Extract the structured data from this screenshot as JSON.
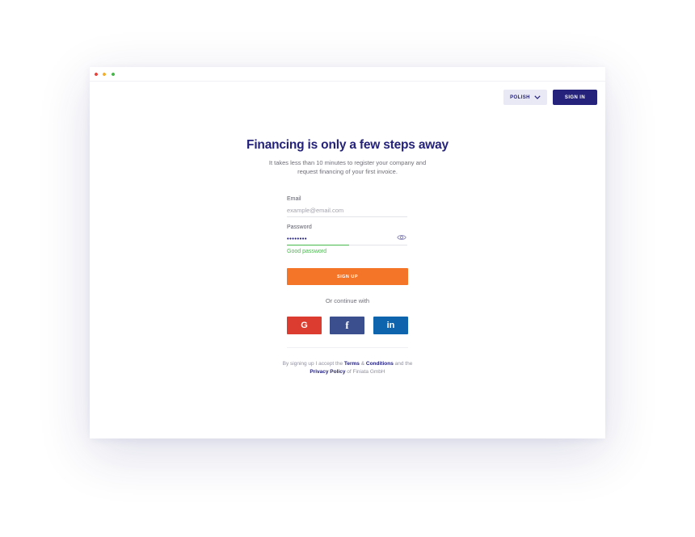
{
  "header": {
    "language_button": "POLISH",
    "signin_button": "SIGN IN"
  },
  "hero": {
    "title": "Financing is only a few steps away",
    "subtitle": "It takes less than 10 minutes to register your company and request financing of your first invoice."
  },
  "form": {
    "email_label": "Email",
    "email_placeholder": "example@email.com",
    "password_label": "Password",
    "password_value": "••••••••",
    "password_status": "Good password",
    "password_strength": 0.52,
    "signup_button": "SIGN UP"
  },
  "social": {
    "continue_text": "Or continue with",
    "google": "G",
    "facebook": "f",
    "linkedin": "in"
  },
  "terms": {
    "prefix": "By signing up I accept the",
    "terms_link": "Terms",
    "amp": "&",
    "conditions_link": "Conditions",
    "and_the": "and the",
    "privacy_link": "Privacy Policy",
    "suffix": "of Finiata GmbH"
  },
  "colors": {
    "primary": "#24227a",
    "accent": "#f47428",
    "success": "#45b94a",
    "google": "#dc3b2f",
    "facebook": "#3b4f8f",
    "linkedin": "#0f65ad"
  }
}
